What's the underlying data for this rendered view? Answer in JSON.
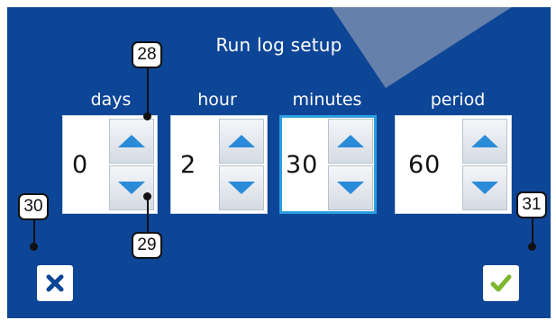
{
  "screen": {
    "title": "Run log setup",
    "background": "#0d4597",
    "accent": "#2a8bd8"
  },
  "spinners": [
    {
      "label": "days",
      "value": "0"
    },
    {
      "label": "hour",
      "value": "2"
    },
    {
      "label": "minutes",
      "value": "30"
    },
    {
      "label": "period",
      "value": "60"
    }
  ],
  "actions": {
    "cancel_icon": "x-icon",
    "confirm_icon": "check-icon",
    "cancel_color": "#0d4597",
    "confirm_color": "#7cb82f"
  },
  "callouts": [
    "28",
    "29",
    "30",
    "31"
  ]
}
